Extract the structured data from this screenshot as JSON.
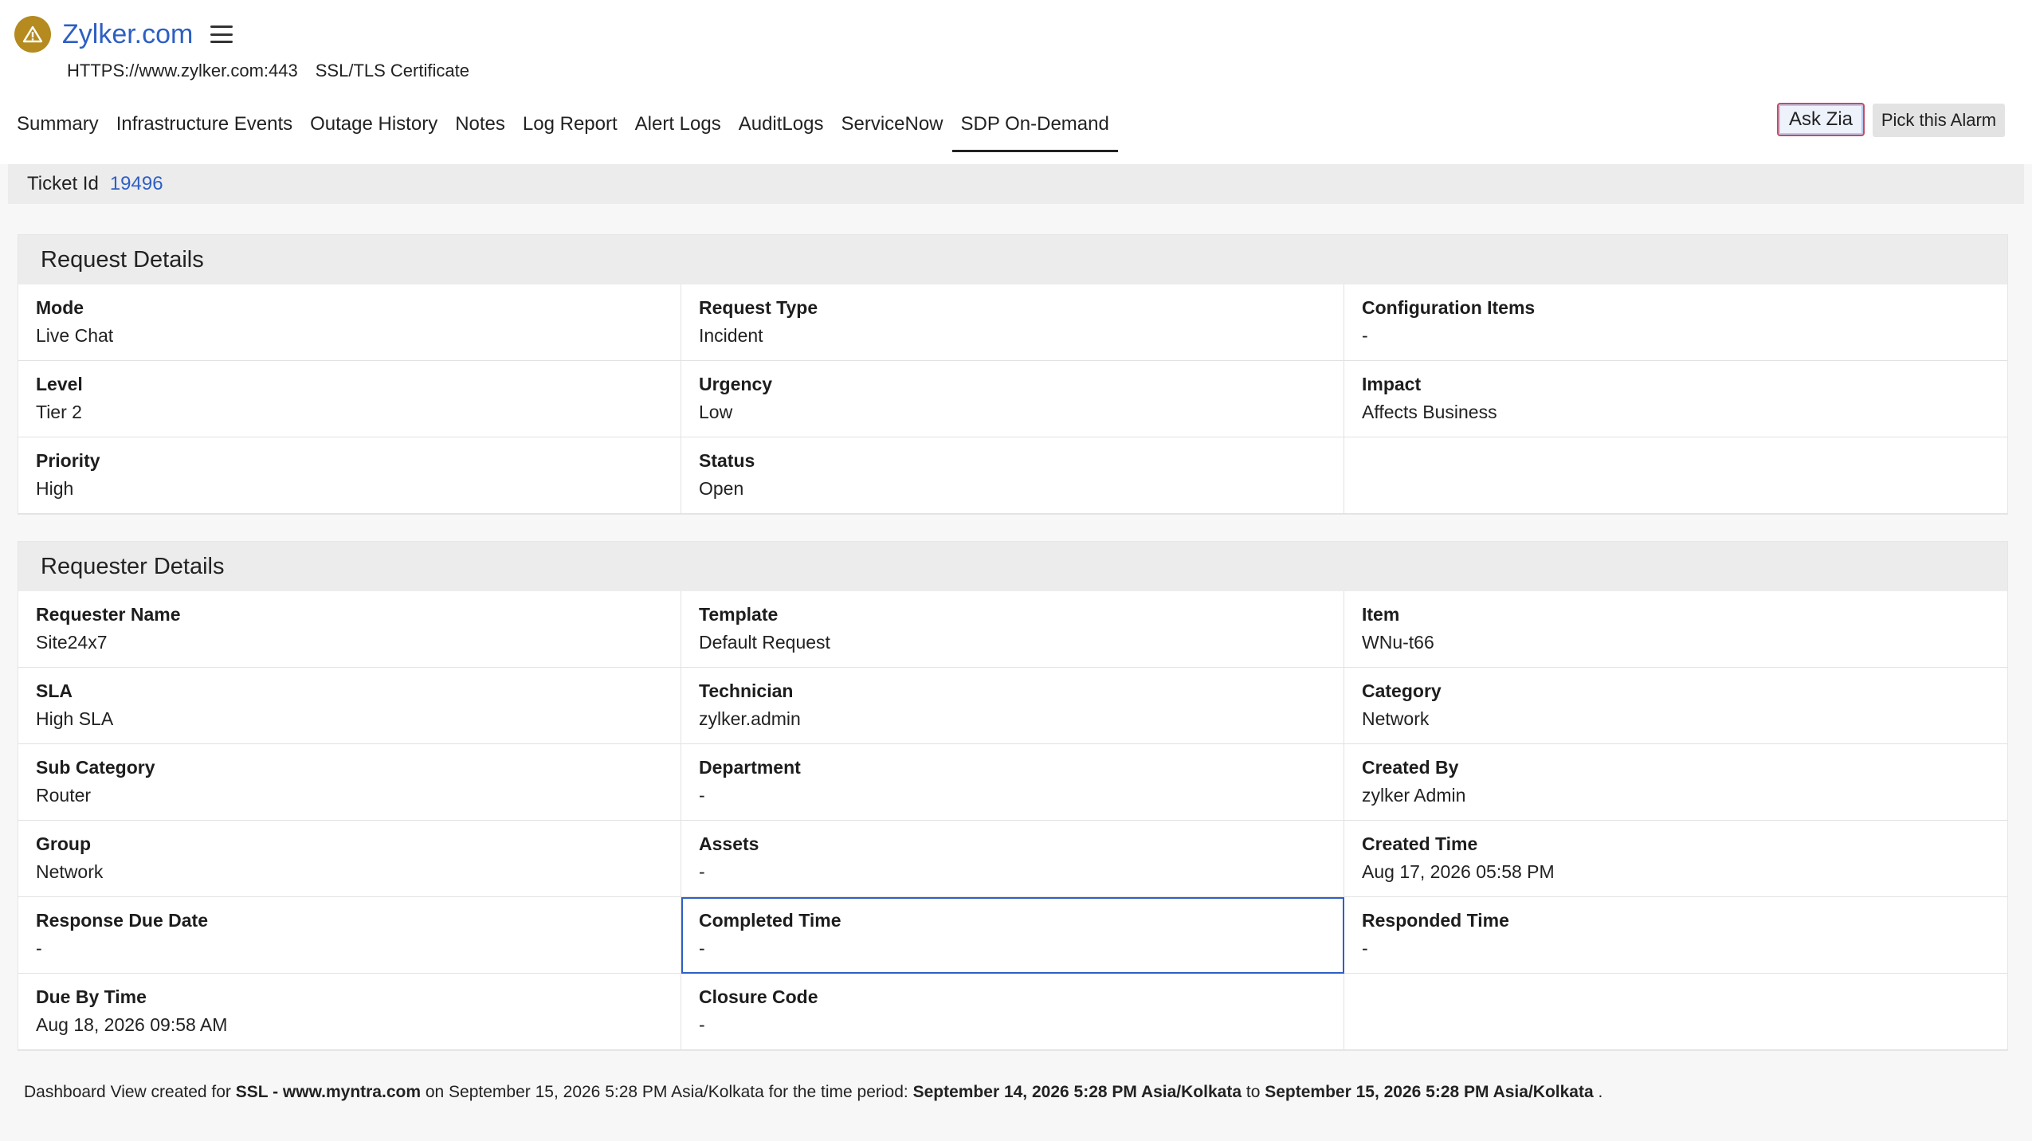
{
  "header": {
    "title": "Zylker.com",
    "url": "HTTPS://www.zylker.com:443",
    "monitor_type": "SSL/TLS Certificate",
    "alert_color": "#b58a1e",
    "accent": "#2d5fc4"
  },
  "tabs": [
    {
      "label": "Summary",
      "active": false
    },
    {
      "label": "Infrastructure Events",
      "active": false
    },
    {
      "label": "Outage History",
      "active": false
    },
    {
      "label": "Notes",
      "active": false
    },
    {
      "label": "Log Report",
      "active": false
    },
    {
      "label": "Alert Logs",
      "active": false
    },
    {
      "label": "AuditLogs",
      "active": false
    },
    {
      "label": "ServiceNow",
      "active": false
    },
    {
      "label": "SDP On-Demand",
      "active": true
    }
  ],
  "actions": {
    "ask_zia": "Ask Zia",
    "pick_alarm": "Pick this Alarm"
  },
  "ticket": {
    "label": "Ticket Id",
    "id": "19496"
  },
  "request_details": {
    "title": "Request Details",
    "fields": [
      {
        "label": "Mode",
        "value": "Live Chat"
      },
      {
        "label": "Request Type",
        "value": "Incident"
      },
      {
        "label": "Configuration Items",
        "value": "-"
      },
      {
        "label": "Level",
        "value": "Tier 2"
      },
      {
        "label": "Urgency",
        "value": "Low"
      },
      {
        "label": "Impact",
        "value": "Affects Business"
      },
      {
        "label": "Priority",
        "value": "High"
      },
      {
        "label": "Status",
        "value": "Open"
      },
      {
        "label": "",
        "value": ""
      }
    ]
  },
  "requester_details": {
    "title": "Requester Details",
    "fields": [
      {
        "label": "Requester Name",
        "value": "Site24x7"
      },
      {
        "label": "Template",
        "value": "Default Request"
      },
      {
        "label": "Item",
        "value": "WNu-t66"
      },
      {
        "label": "SLA",
        "value": "High SLA"
      },
      {
        "label": "Technician",
        "value": "zylker.admin"
      },
      {
        "label": "Category",
        "value": "Network"
      },
      {
        "label": "Sub Category",
        "value": "Router"
      },
      {
        "label": "Department",
        "value": "-"
      },
      {
        "label": "Created By",
        "value": "zylker Admin"
      },
      {
        "label": "Group",
        "value": "Network"
      },
      {
        "label": "Assets",
        "value": "-"
      },
      {
        "label": "Created Time",
        "value": "Aug 17, 2026 05:58 PM"
      },
      {
        "label": "Response Due Date",
        "value": "-"
      },
      {
        "label": "Completed Time",
        "value": "-"
      },
      {
        "label": "Responded Time",
        "value": "-"
      },
      {
        "label": "Due By Time",
        "value": "Aug 18, 2026 09:58 AM"
      },
      {
        "label": "Closure Code",
        "value": "-"
      },
      {
        "label": "",
        "value": ""
      }
    ]
  },
  "footer": {
    "prefix": "Dashboard View created for",
    "monitor": "SSL - www.myntra.com",
    "created_on": "on September 15, 2026 5:28 PM Asia/Kolkata for the time period:",
    "period_start": "September 14, 2026 5:28 PM Asia/Kolkata",
    "to": "to",
    "period_end": "September 15, 2026 5:28 PM Asia/Kolkata",
    "suffix": "."
  }
}
